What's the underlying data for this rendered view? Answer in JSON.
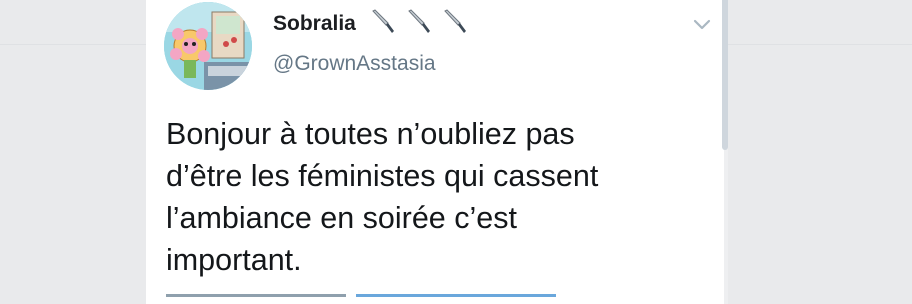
{
  "tweet": {
    "display_name": "Sobralia",
    "handle": "@GrownAsstasia",
    "text_lines": [
      "Bonjour à toutes n’oubliez pas",
      "d’être les féministes qui cassent",
      "l’ambiance en soirée c’est",
      "important."
    ],
    "name_emojis": [
      "knife-icon",
      "knife-icon",
      "knife-icon"
    ]
  },
  "colors": {
    "name": "#1c1e21",
    "handle": "#657786",
    "text": "#14171a",
    "card": "#ffffff",
    "page_bg": "#eeeff1"
  }
}
